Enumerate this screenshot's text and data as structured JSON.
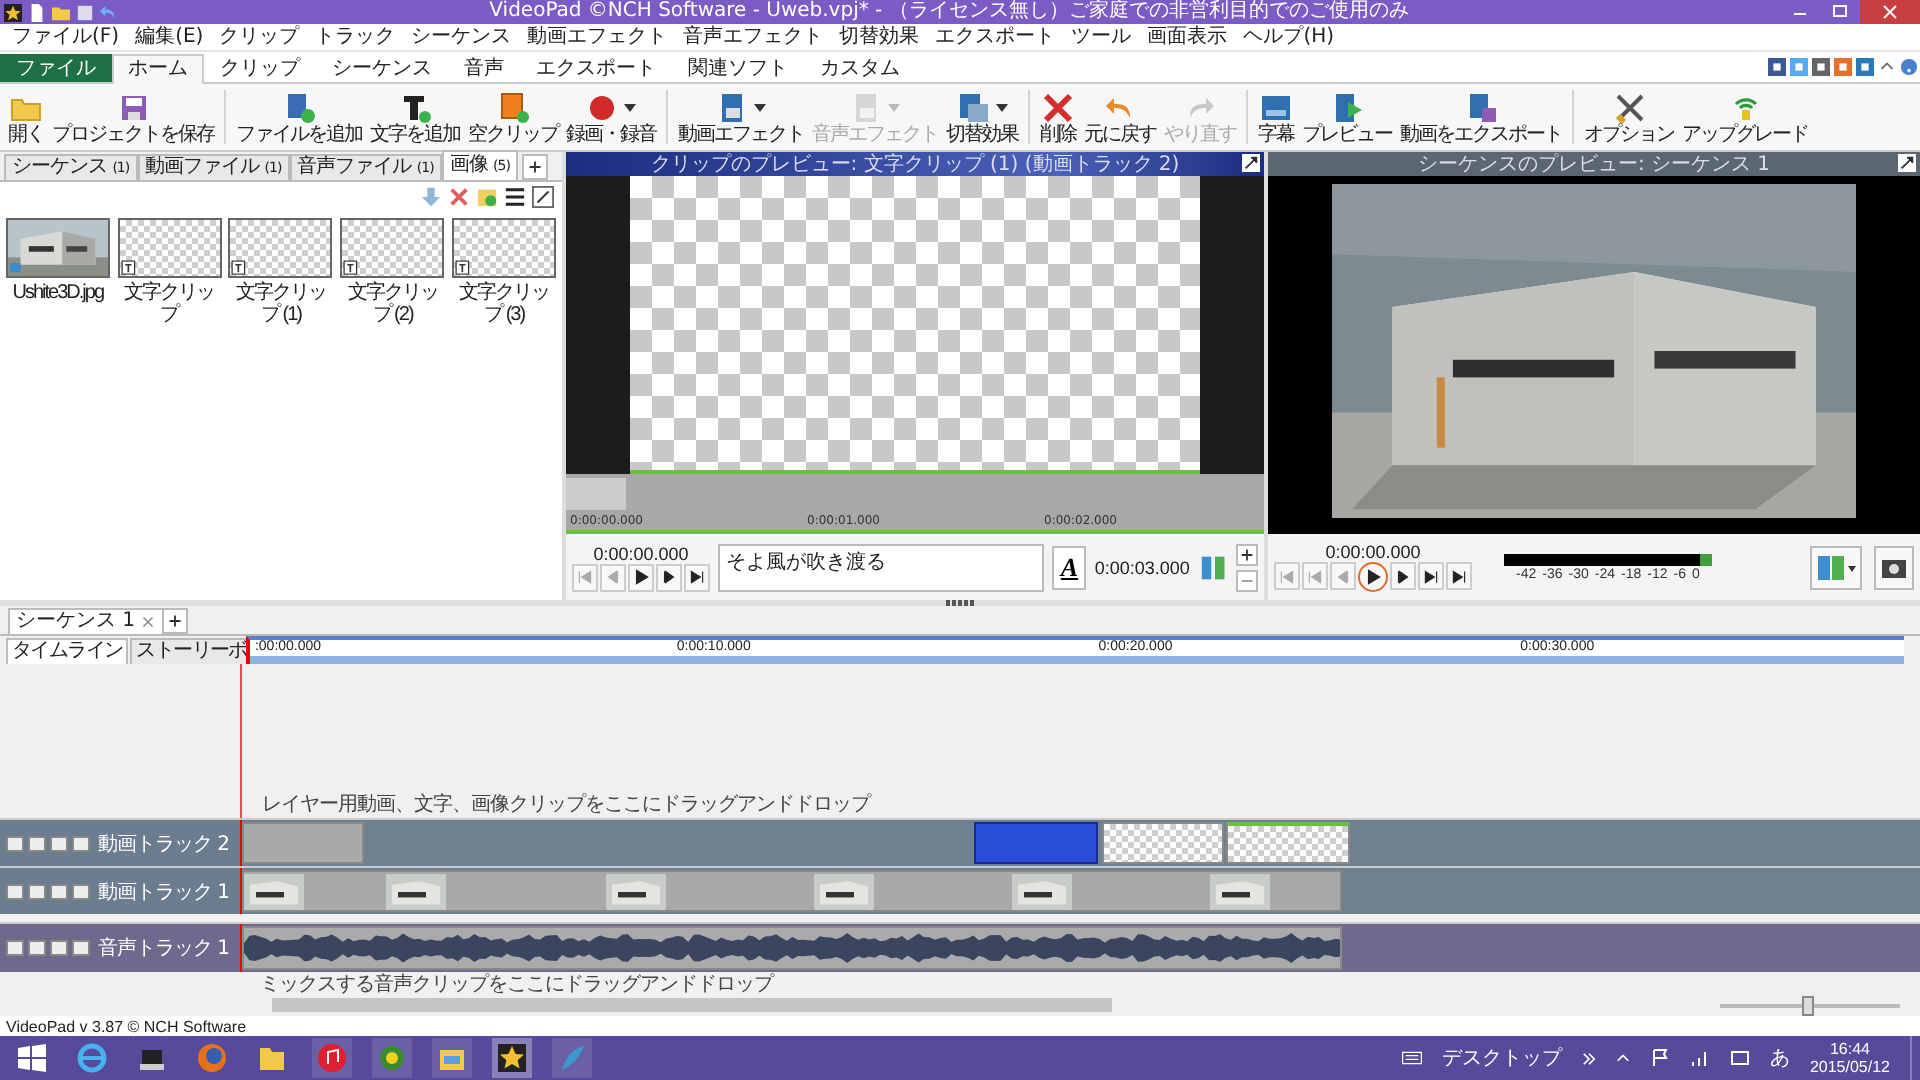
{
  "window": {
    "title": "VideoPad ©NCH Software - Uweb.vpj* - （ライセンス無し）ご家庭での非営利目的でのご使用のみ"
  },
  "menu": [
    "ファイル(F)",
    "編集(E)",
    "クリップ",
    "トラック",
    "シーケンス",
    "動画エフェクト",
    "音声エフェクト",
    "切替効果",
    "エクスポート",
    "ツール",
    "画面表示",
    "ヘルプ(H)"
  ],
  "ribbon_tabs": [
    {
      "label": "ファイル",
      "kind": "file",
      "selected": false
    },
    {
      "label": "ホーム",
      "kind": "tab",
      "selected": true
    },
    {
      "label": "クリップ",
      "kind": "tab",
      "selected": false
    },
    {
      "label": "シーケンス",
      "kind": "tab",
      "selected": false
    },
    {
      "label": "音声",
      "kind": "tab",
      "selected": false
    },
    {
      "label": "エクスポート",
      "kind": "tab",
      "selected": false
    },
    {
      "label": "関連ソフト",
      "kind": "tab",
      "selected": false
    },
    {
      "label": "カスタム",
      "kind": "tab",
      "selected": false
    }
  ],
  "toolbar": [
    [
      {
        "label": "開く",
        "disabled": false,
        "dropdown": false
      },
      {
        "label": "プロジェクトを保存",
        "disabled": false,
        "dropdown": false
      }
    ],
    [
      {
        "label": "ファイルを追加",
        "disabled": false,
        "dropdown": false
      },
      {
        "label": "文字を追加",
        "disabled": false,
        "dropdown": false
      },
      {
        "label": "空クリップ",
        "disabled": false,
        "dropdown": false
      },
      {
        "label": "録画・録音",
        "disabled": false,
        "dropdown": true
      }
    ],
    [
      {
        "label": "動画エフェクト",
        "disabled": false,
        "dropdown": true
      },
      {
        "label": "音声エフェクト",
        "disabled": true,
        "dropdown": true
      },
      {
        "label": "切替効果",
        "disabled": false,
        "dropdown": true
      }
    ],
    [
      {
        "label": "削除",
        "disabled": false,
        "dropdown": false
      },
      {
        "label": "元に戻す",
        "disabled": false,
        "dropdown": false
      },
      {
        "label": "やり直す",
        "disabled": true,
        "dropdown": false
      }
    ],
    [
      {
        "label": "字幕",
        "disabled": false,
        "dropdown": false
      },
      {
        "label": "プレビュー",
        "disabled": false,
        "dropdown": false
      },
      {
        "label": "動画をエクスポート",
        "disabled": false,
        "dropdown": false
      }
    ],
    [
      {
        "label": "オプション",
        "disabled": false,
        "dropdown": false
      },
      {
        "label": "アップグレード",
        "disabled": false,
        "dropdown": false
      }
    ]
  ],
  "bin_tabs": [
    {
      "label": "シーケンス",
      "count": "(1)",
      "selected": false
    },
    {
      "label": "動画ファイル",
      "count": "(1)",
      "selected": false
    },
    {
      "label": "音声ファイル",
      "count": "(1)",
      "selected": false
    },
    {
      "label": "画像",
      "count": "(5)",
      "selected": true
    }
  ],
  "bin_items": [
    {
      "name": "Ushite3D.jpg"
    },
    {
      "name": "文字クリップ",
      "kind": "text"
    },
    {
      "name": "文字クリップ (1)",
      "kind": "text"
    },
    {
      "name": "文字クリップ (2)",
      "kind": "text"
    },
    {
      "name": "文字クリップ (3)",
      "kind": "text"
    }
  ],
  "clip_preview": {
    "title": "クリップのプレビュー: 文字クリップ (1) (動画トラック 2)",
    "ruler": [
      "0:00:00.000",
      "0:00:01.000",
      "0:00:02.000"
    ],
    "time": "0:00:00.000",
    "text": "そよ風が吹き渡る",
    "font_button": "A",
    "duration": "0:00:03.000"
  },
  "sequence_preview": {
    "title": "シーケンスのプレビュー: シーケンス 1",
    "time": "0:00:00.000",
    "meter_labels": [
      "-42",
      "-36",
      "-30",
      "-24",
      "-18",
      "-12",
      "-6",
      "0"
    ]
  },
  "sequence_tabs": [
    {
      "label": "シーケンス 1",
      "selected": true
    }
  ],
  "timeline": {
    "view_tabs": [
      {
        "label": "タイムライン",
        "selected": true
      },
      {
        "label": "ストーリーボ",
        "selected": false
      }
    ],
    "ruler": [
      ":00:00.000",
      "0:00:10.000",
      "0:00:20.000",
      "0:00:30.000"
    ],
    "overlay_hint": "レイヤー用動画、文字、画像クリップをここにドラッグアンドドロップ",
    "tracks": [
      {
        "name": "動画トラック 2",
        "kind": "overlay"
      },
      {
        "name": "動画トラック 1",
        "kind": "video"
      },
      {
        "name": "音声トラック 1",
        "kind": "audio"
      }
    ],
    "audio_hint": "ミックスする音声クリップをここにドラッグアンドドロップ",
    "zoom": {
      "level": 0.45
    }
  },
  "status_bar": "VideoPad v 3.87 © NCH Software",
  "taskbar": {
    "tray_label": "デスクトップ",
    "ime": "あ",
    "time": "16:44",
    "date": "2015/05/12"
  }
}
